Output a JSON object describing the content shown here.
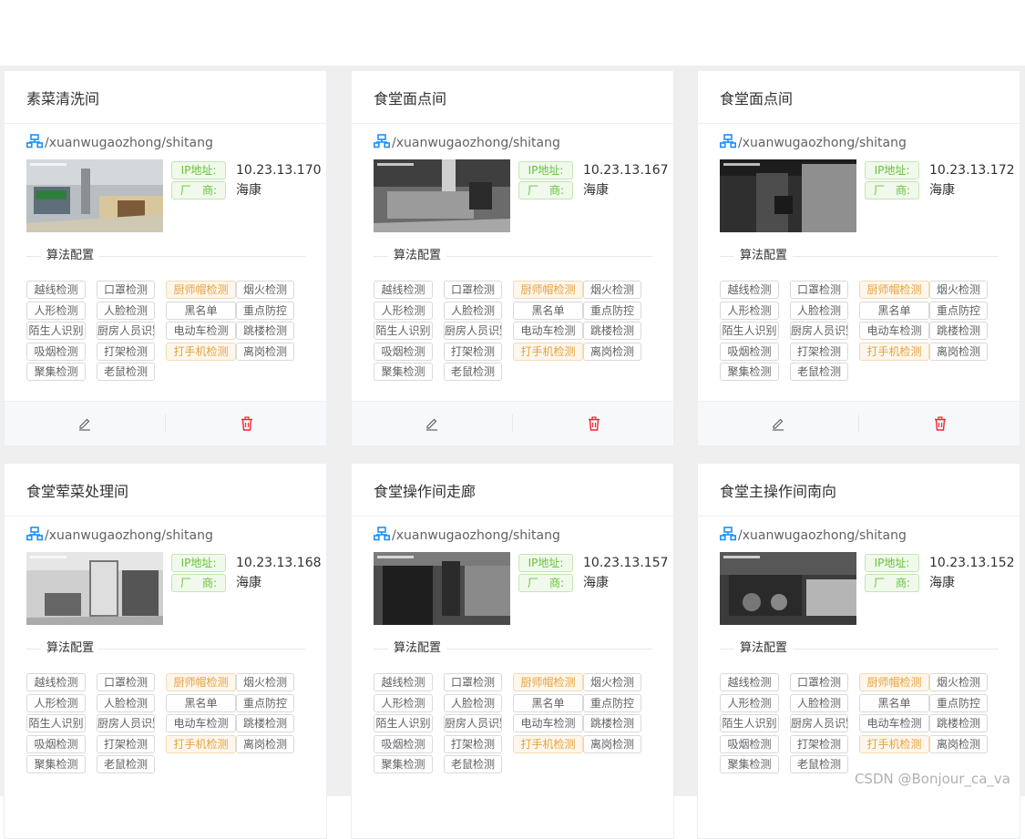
{
  "path": "/xuanwugaozhong/shitang",
  "ip_label": "IP地址:",
  "vendor_label": "厂　商:",
  "algo_label": "算法配置",
  "tags": [
    {
      "label": "越线检测",
      "active": false
    },
    {
      "label": "口罩检测",
      "active": false
    },
    {
      "label": "厨师帽检测",
      "active": true
    },
    {
      "label": "烟火检测",
      "active": false
    },
    {
      "label": "人形检测",
      "active": false
    },
    {
      "label": "人脸检测",
      "active": false
    },
    {
      "label": "黑名单",
      "active": false
    },
    {
      "label": "重点防控",
      "active": false
    },
    {
      "label": "陌生人识别",
      "active": false
    },
    {
      "label": "厨房人员识别",
      "active": false
    },
    {
      "label": "电动车检测",
      "active": false
    },
    {
      "label": "跳楼检测",
      "active": false
    },
    {
      "label": "吸烟检测",
      "active": false
    },
    {
      "label": "打架检测",
      "active": false
    },
    {
      "label": "打手机检测",
      "active": true
    },
    {
      "label": "离岗检测",
      "active": false
    },
    {
      "label": "聚集检测",
      "active": false
    },
    {
      "label": "老鼠检测",
      "active": false
    }
  ],
  "cameras": [
    {
      "title": "素菜清洗间",
      "ip": "10.23.13.170",
      "vendor": "海康",
      "show_footer": true
    },
    {
      "title": "食堂面点间",
      "ip": "10.23.13.167",
      "vendor": "海康",
      "show_footer": true
    },
    {
      "title": "食堂面点间",
      "ip": "10.23.13.172",
      "vendor": "海康",
      "show_footer": true
    },
    {
      "title": "食堂荤菜处理间",
      "ip": "10.23.13.168",
      "vendor": "海康",
      "show_footer": false
    },
    {
      "title": "食堂操作间走廊",
      "ip": "10.23.13.157",
      "vendor": "海康",
      "show_footer": false
    },
    {
      "title": "食堂主操作间南向",
      "ip": "10.23.13.152",
      "vendor": "海康",
      "show_footer": false
    }
  ],
  "colors": {
    "network_icon": "#1890ff",
    "delete_icon": "#f5222d",
    "tag_active": "#e6a23c",
    "info_tag": "#67c23a"
  },
  "icons": {
    "path": "network-icon",
    "edit": "edit-icon",
    "delete": "trash-icon"
  },
  "watermark": "CSDN @Bonjour_ca_va"
}
